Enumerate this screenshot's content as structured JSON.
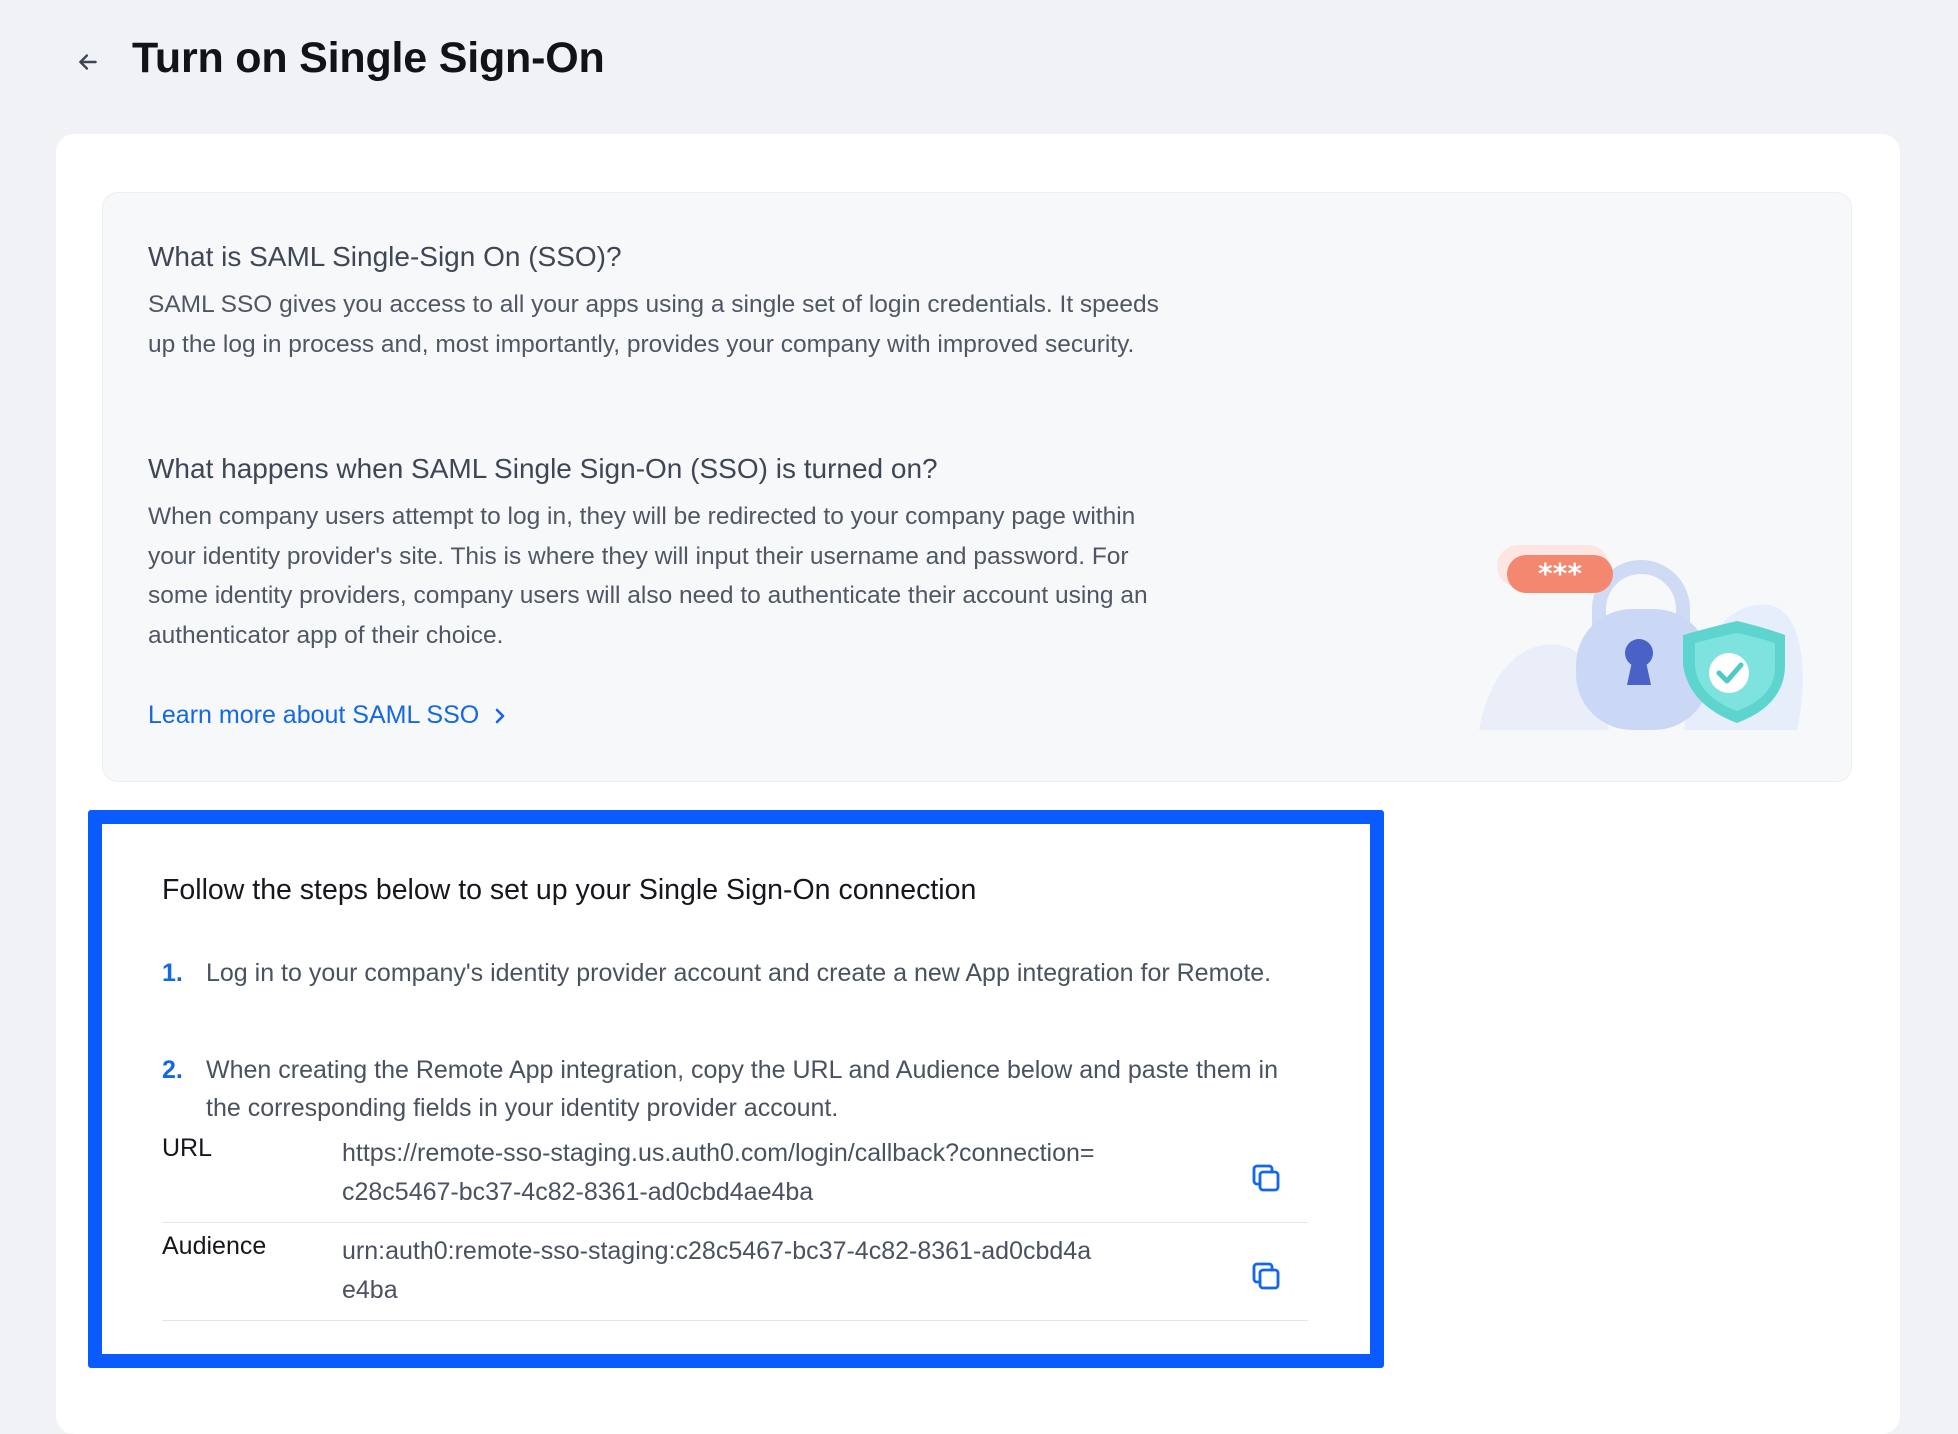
{
  "header": {
    "back_icon": "arrow-left-icon",
    "title": "Turn on Single Sign-On"
  },
  "info": {
    "heading_1": "What is SAML Single-Sign On (SSO)?",
    "text_1": "SAML SSO gives you access to all your apps using a single set of login credentials. It speeds up the log in process and, most importantly, provides your company with improved security.",
    "heading_2": "What happens when SAML Single Sign-On (SSO) is turned on?",
    "text_2": "When company users attempt to log in, they will be redirected to your company page within your identity provider's site. This is where they will input their username and password. For some identity providers, company users will also need to authenticate their account using an authenticator app of their choice.",
    "learn_more_label": "Learn more about SAML SSO",
    "illustration_password": "***"
  },
  "steps": {
    "title": "Follow the steps below to set up your Single Sign-On connection",
    "items": [
      {
        "num": "1.",
        "text": "Log in to your company's identity provider account and create a new App integration for Remote."
      },
      {
        "num": "2.",
        "text": "When creating the Remote App integration, copy the URL and Audience below and paste them in the corresponding fields in your identity provider account."
      }
    ],
    "fields": [
      {
        "label": "URL",
        "value": "https://remote-sso-staging.us.auth0.com/login/callback?connection=c28c5467-bc37-4c82-8361-ad0cbd4ae4ba",
        "copy_icon": "copy-icon"
      },
      {
        "label": "Audience",
        "value": "urn:auth0:remote-sso-staging:c28c5467-bc37-4c82-8361-ad0cbd4ae4ba",
        "copy_icon": "copy-icon"
      }
    ]
  },
  "colors": {
    "accent": "#1467e8",
    "highlight_border": "#0a5bff",
    "background": "#f1f2f5"
  }
}
